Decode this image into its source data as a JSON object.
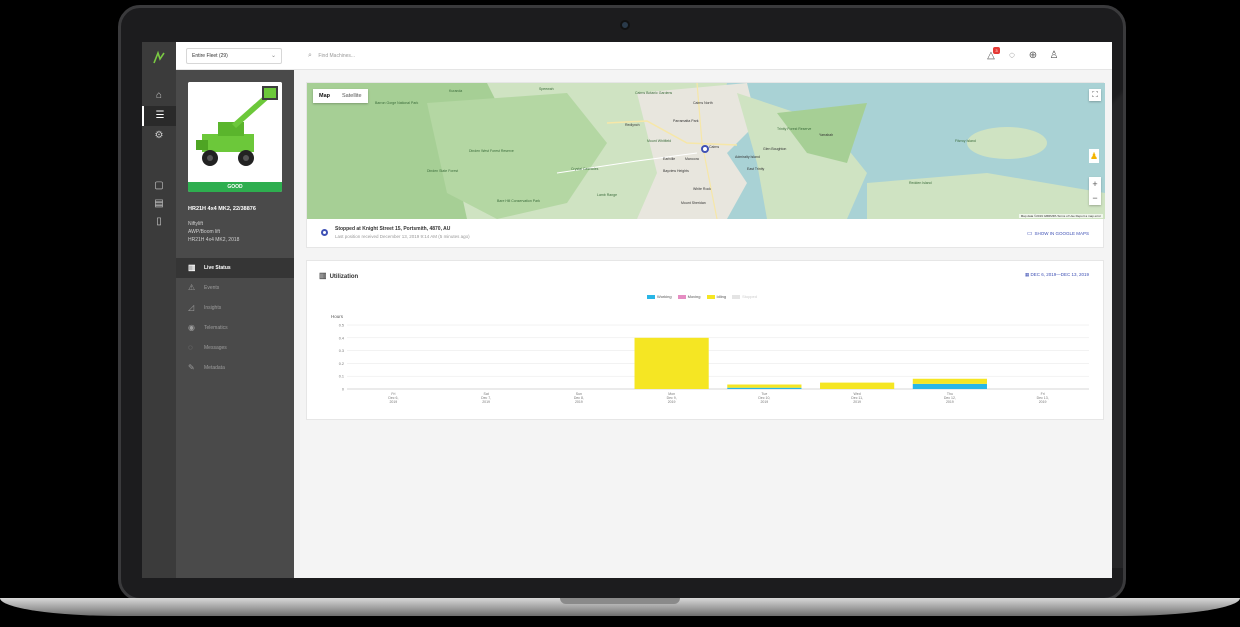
{
  "topbar": {
    "fleet_select": "Entire Fleet (29)",
    "search_placeholder": "Find Machines...",
    "alert_count": "3"
  },
  "machine": {
    "status": "GOOD",
    "title": "HR21H 4x4 MK2, 22/38876",
    "meta": [
      "Niftylift",
      "AWP/Boom lift",
      "HR21H 4x4 MK2, 2018"
    ]
  },
  "menu": [
    {
      "label": "Live Status",
      "icon": "bar-chart-icon",
      "active": true
    },
    {
      "label": "Events",
      "icon": "warning-icon",
      "active": false
    },
    {
      "label": "Insights",
      "icon": "insights-icon",
      "active": false
    },
    {
      "label": "Telematics",
      "icon": "signal-icon",
      "active": false
    },
    {
      "label": "Messages",
      "icon": "chat-icon",
      "active": false
    },
    {
      "label": "Metadata",
      "icon": "edit-icon",
      "active": false
    }
  ],
  "map": {
    "tabs": [
      "Map",
      "Satellite"
    ],
    "attribution": "Map data ©2019 GBRMPA   Terms of Use   Report a map error",
    "labels": [
      "Kuranda",
      "Speewah",
      "Cairns Botanic Gardens",
      "Cairns North",
      "Barron Gorge National Park",
      "Redlynch",
      "Parramatta Park",
      "Trinity Forest Reserve",
      "Yarrabah",
      "Fitzroy Island",
      "Crystal Cascades",
      "Bayview Heights",
      "Admiralty Island",
      "East Trinity",
      "White Rock",
      "Lamb Range",
      "Mount Sheridan",
      "Dinden West Forest Reserve",
      "Dinden State Forest",
      "Bare Hill Conservation Park",
      "Cairns",
      "Earlville",
      "Manoora",
      "Glen Boughton",
      "Mount Whitfield",
      "Redden Island"
    ],
    "location_title": "Stopped at Knight Street 15, Portsmith, 4870, AU",
    "location_sub": "Last position received December 13, 2019 9:14 AM (5 minutes ago)",
    "gmaps_link": "SHOW IN GOOGLE MAPS"
  },
  "utilization": {
    "title": "Utilization",
    "date_range": "DEC 6, 2019—DEC 13, 2019",
    "legend": [
      {
        "name": "Working",
        "color": "#29b6e6",
        "active": true
      },
      {
        "name": "Moving",
        "color": "#e58cc2",
        "active": true
      },
      {
        "name": "Idling",
        "color": "#f5e623",
        "active": true
      },
      {
        "name": "Stopped",
        "color": "#cfcfcf",
        "active": false
      }
    ]
  },
  "chart_data": {
    "type": "bar",
    "stacked": true,
    "ylabel": "Hours",
    "ylim": [
      0,
      0.5
    ],
    "yticks": [
      "0",
      "0.1",
      "0.2",
      "0.3",
      "0.4",
      "0.5"
    ],
    "categories": [
      [
        "Fri",
        "Dec 6,",
        "2019"
      ],
      [
        "Sat",
        "Dec 7,",
        "2019"
      ],
      [
        "Sun",
        "Dec 8,",
        "2019"
      ],
      [
        "Mon",
        "Dec 9,",
        "2019"
      ],
      [
        "Tue",
        "Dec 10,",
        "2019"
      ],
      [
        "Wed",
        "Dec 11,",
        "2019"
      ],
      [
        "Thu",
        "Dec 12,",
        "2019"
      ],
      [
        "Fri",
        "Dec 13,",
        "2019"
      ]
    ],
    "series": [
      {
        "name": "Working",
        "color": "#29b6e6",
        "values": [
          0,
          0,
          0,
          0,
          0.01,
          0,
          0.04,
          0
        ]
      },
      {
        "name": "Moving",
        "color": "#e58cc2",
        "values": [
          0,
          0,
          0,
          0,
          0,
          0,
          0,
          0
        ]
      },
      {
        "name": "Idling",
        "color": "#f5e623",
        "values": [
          0,
          0,
          0,
          0.4,
          0.025,
          0.05,
          0.04,
          0
        ]
      }
    ]
  }
}
